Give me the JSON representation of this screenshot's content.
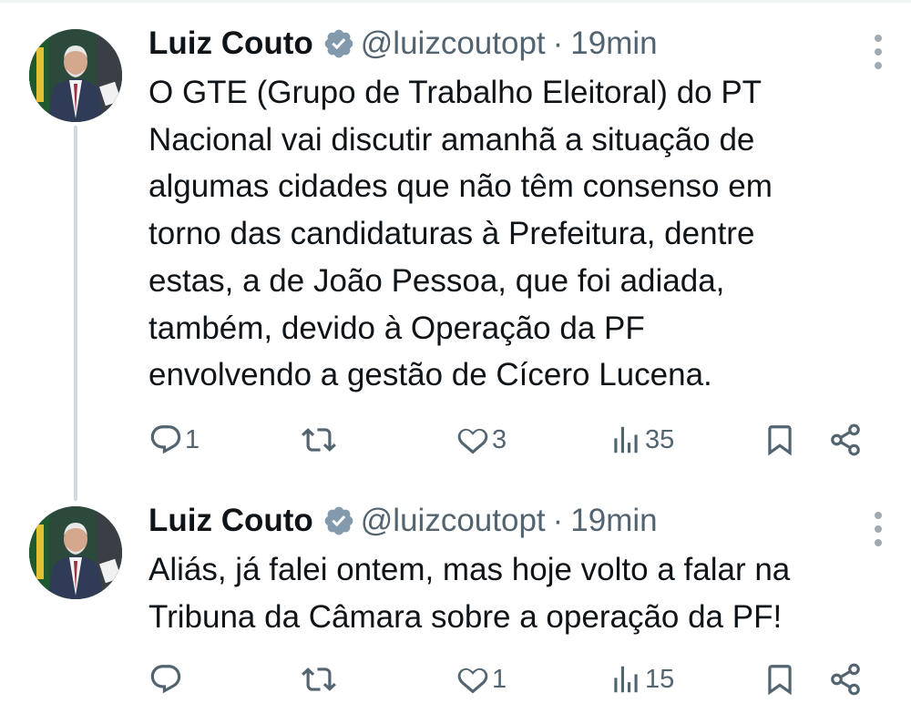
{
  "tweets": [
    {
      "author": "Luiz Couto",
      "handle": "@luizcoutopt",
      "separator": "·",
      "time": "19min",
      "text": "O GTE (Grupo de Trabalho Eleitoral) do PT\nNacional vai discutir amanhã a situação de\nalgumas cidades que não têm consenso em\ntorno das candidaturas à Prefeitura, dentre\nestas, a de João Pessoa, que foi adiada,\ntambém, devido à Operação da PF\nenvolvendo a gestão de Cícero Lucena.",
      "replies": "1",
      "reposts": "",
      "likes": "3",
      "views": "35"
    },
    {
      "author": "Luiz Couto",
      "handle": "@luizcoutopt",
      "separator": "·",
      "time": "19min",
      "text": "Aliás, já falei ontem, mas hoje volto a falar na\nTribuna da Câmara sobre a operação da PF!",
      "replies": "",
      "reposts": "",
      "likes": "1",
      "views": "15"
    }
  ],
  "icons": {
    "verified": "verified-badge-icon",
    "more": "more-vertical-icon",
    "reply": "reply-icon",
    "repost": "repost-icon",
    "like": "like-icon",
    "views": "views-icon",
    "bookmark": "bookmark-icon",
    "share": "share-icon"
  },
  "colors": {
    "text": "#0f1419",
    "secondary": "#536471",
    "thread_line": "#cfd9de",
    "badge": "#829aab"
  }
}
